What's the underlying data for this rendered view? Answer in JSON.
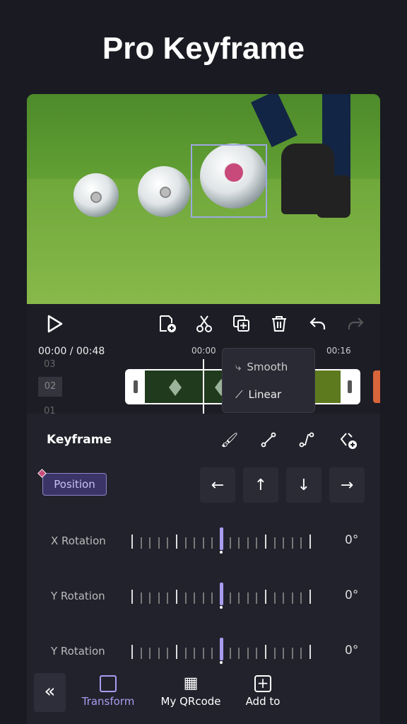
{
  "title": "Pro Keyframe",
  "toolbar": {
    "icons": [
      "play-icon",
      "add-clip-icon",
      "split-icon",
      "duplicate-icon",
      "trash-icon",
      "undo-icon",
      "redo-icon"
    ]
  },
  "timeline": {
    "current": "00:00 / 00:48",
    "mark1": "00:00",
    "mark2": "00:16",
    "layers": [
      "03",
      "02",
      "01"
    ]
  },
  "popup": {
    "smooth": "Smooth",
    "linear": "Linear"
  },
  "keyframe": {
    "title": "Keyframe",
    "position_label": "Position"
  },
  "rows": [
    {
      "label": "X Rotation",
      "value": "0°"
    },
    {
      "label": "Y Rotation",
      "value": "0°"
    },
    {
      "label": "Y Rotation",
      "value": "0°"
    }
  ],
  "bottom": {
    "transform": "Transform",
    "qrcode": "My QRcode",
    "addto": "Add to"
  },
  "colors": {
    "accent": "#a99cf0",
    "keyframe_marker": "#c74a7a",
    "track": "#1f3a1c"
  }
}
